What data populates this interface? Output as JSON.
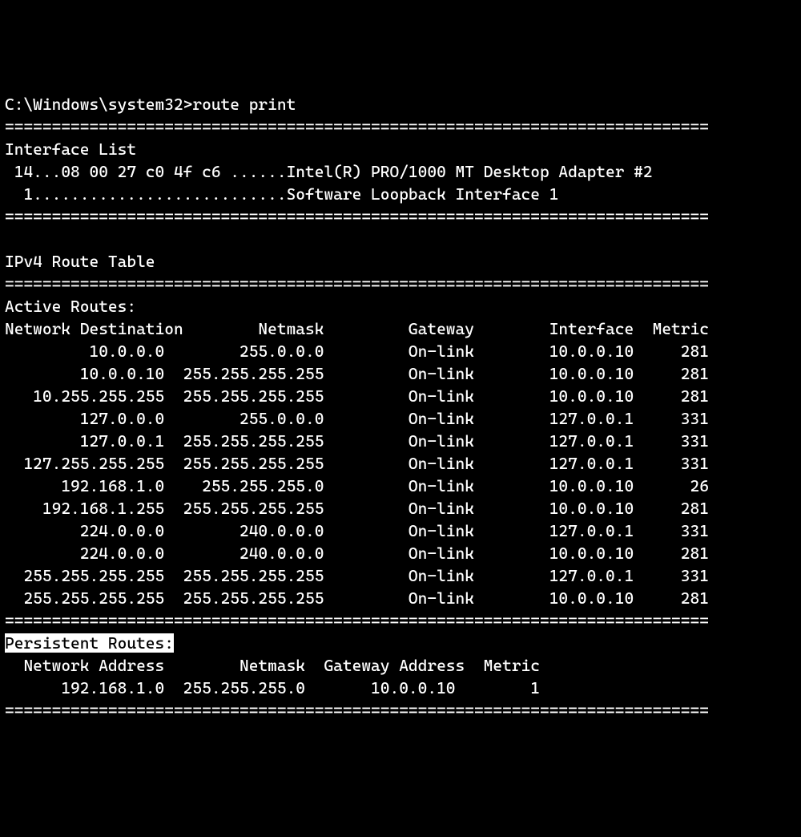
{
  "prompt": {
    "path": "C:\\Windows\\system32>",
    "command": "route print"
  },
  "divider": "===========================================================================",
  "interface_list": {
    "title": "Interface List",
    "iface1": " 14...08 00 27 c0 4f c6 ......Intel(R) PRO/1000 MT Desktop Adapter #2",
    "iface2": "  1...........................Software Loopback Interface 1"
  },
  "ipv4": {
    "title": "IPv4 Route Table",
    "active_title": "Active Routes:",
    "header": {
      "dest": "Network Destination",
      "mask": "Netmask",
      "gateway": "Gateway",
      "iface": "Interface",
      "metric": "Metric"
    },
    "routes": [
      {
        "dest": "10.0.0.0",
        "mask": "255.0.0.0",
        "gateway": "On-link",
        "iface": "10.0.0.10",
        "metric": "281"
      },
      {
        "dest": "10.0.0.10",
        "mask": "255.255.255.255",
        "gateway": "On-link",
        "iface": "10.0.0.10",
        "metric": "281"
      },
      {
        "dest": "10.255.255.255",
        "mask": "255.255.255.255",
        "gateway": "On-link",
        "iface": "10.0.0.10",
        "metric": "281"
      },
      {
        "dest": "127.0.0.0",
        "mask": "255.0.0.0",
        "gateway": "On-link",
        "iface": "127.0.0.1",
        "metric": "331"
      },
      {
        "dest": "127.0.0.1",
        "mask": "255.255.255.255",
        "gateway": "On-link",
        "iface": "127.0.0.1",
        "metric": "331"
      },
      {
        "dest": "127.255.255.255",
        "mask": "255.255.255.255",
        "gateway": "On-link",
        "iface": "127.0.0.1",
        "metric": "331"
      },
      {
        "dest": "192.168.1.0",
        "mask": "255.255.255.0",
        "gateway": "On-link",
        "iface": "10.0.0.10",
        "metric": "26"
      },
      {
        "dest": "192.168.1.255",
        "mask": "255.255.255.255",
        "gateway": "On-link",
        "iface": "10.0.0.10",
        "metric": "281"
      },
      {
        "dest": "224.0.0.0",
        "mask": "240.0.0.0",
        "gateway": "On-link",
        "iface": "127.0.0.1",
        "metric": "331"
      },
      {
        "dest": "224.0.0.0",
        "mask": "240.0.0.0",
        "gateway": "On-link",
        "iface": "10.0.0.10",
        "metric": "281"
      },
      {
        "dest": "255.255.255.255",
        "mask": "255.255.255.255",
        "gateway": "On-link",
        "iface": "127.0.0.1",
        "metric": "331"
      },
      {
        "dest": "255.255.255.255",
        "mask": "255.255.255.255",
        "gateway": "On-link",
        "iface": "10.0.0.10",
        "metric": "281"
      }
    ],
    "persistent": {
      "title": "Persistent Routes:",
      "header": {
        "addr": "Network Address",
        "mask": "Netmask",
        "gateway": "Gateway Address",
        "metric": "Metric"
      },
      "routes": [
        {
          "addr": "192.168.1.0",
          "mask": "255.255.255.0",
          "gateway": "10.0.0.10",
          "metric": "1"
        }
      ]
    }
  }
}
